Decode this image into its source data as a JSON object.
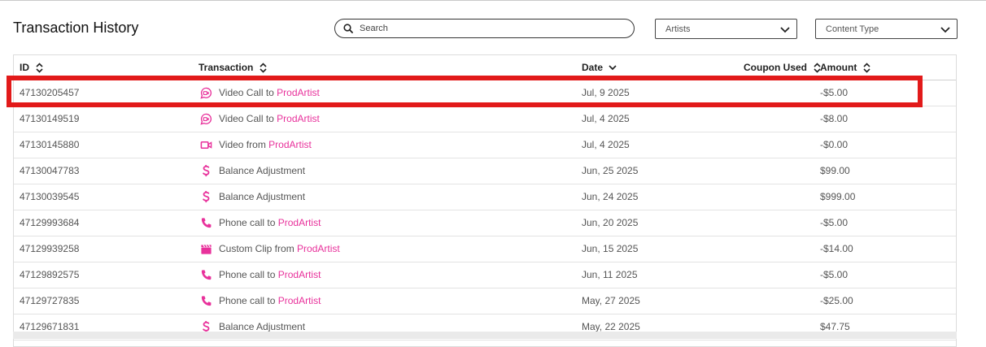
{
  "page": {
    "title": "Transaction History"
  },
  "search": {
    "placeholder": "Search",
    "icon": "search-icon"
  },
  "filters": {
    "artists_label": "Artists",
    "content_type_label": "Content Type"
  },
  "colors": {
    "accent": "#e8319b",
    "highlight": "#e21a1a"
  },
  "table": {
    "headers": {
      "id": "ID",
      "transaction": "Transaction",
      "date": "Date",
      "coupon": "Coupon Used",
      "amount": "Amount"
    },
    "rows": [
      {
        "id": "47130205457",
        "icon": "video-call-icon",
        "text": "Video Call to",
        "link": "ProdArtist",
        "date": "Jul, 9 2025",
        "amount": "-$5.00"
      },
      {
        "id": "47130149519",
        "icon": "video-call-icon",
        "text": "Video Call to",
        "link": "ProdArtist",
        "date": "Jul, 4 2025",
        "amount": "-$8.00"
      },
      {
        "id": "47130145880",
        "icon": "video-icon",
        "text": "Video from",
        "link": "ProdArtist",
        "date": "Jul, 4 2025",
        "amount": "-$0.00"
      },
      {
        "id": "47130047783",
        "icon": "dollar-icon",
        "text": "Balance Adjustment",
        "link": "",
        "date": "Jun, 25 2025",
        "amount": "$99.00"
      },
      {
        "id": "47130039545",
        "icon": "dollar-icon",
        "text": "Balance Adjustment",
        "link": "",
        "date": "Jun, 24 2025",
        "amount": "$999.00"
      },
      {
        "id": "47129993684",
        "icon": "phone-icon",
        "text": "Phone call to",
        "link": "ProdArtist",
        "date": "Jun, 20 2025",
        "amount": "-$5.00"
      },
      {
        "id": "47129939258",
        "icon": "clapperboard-icon",
        "text": "Custom Clip from",
        "link": "ProdArtist",
        "date": "Jun, 15 2025",
        "amount": "-$14.00"
      },
      {
        "id": "47129892575",
        "icon": "phone-icon",
        "text": "Phone call to",
        "link": "ProdArtist",
        "date": "Jun, 11 2025",
        "amount": "-$5.00"
      },
      {
        "id": "47129727835",
        "icon": "phone-icon",
        "text": "Phone call to",
        "link": "ProdArtist",
        "date": "May, 27 2025",
        "amount": "-$25.00"
      },
      {
        "id": "47129671831",
        "icon": "dollar-icon",
        "text": "Balance Adjustment",
        "link": "",
        "date": "May, 22 2025",
        "amount": "$47.75"
      }
    ]
  }
}
